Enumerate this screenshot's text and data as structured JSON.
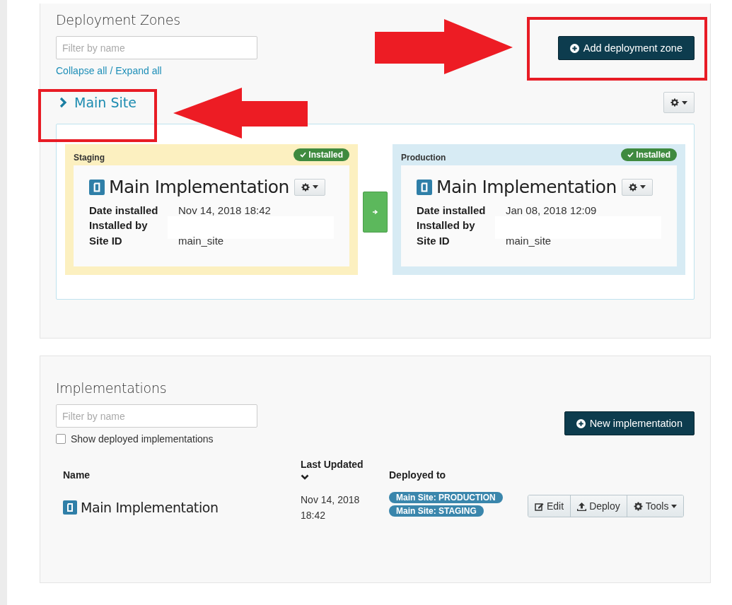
{
  "deployment_zones": {
    "title": "Deployment Zones",
    "filter": {
      "placeholder": "Filter by name"
    },
    "links": [
      "Collapse all",
      "Expand all"
    ],
    "link_separator": "/",
    "add_button": "Add deployment zone",
    "groups": [
      {
        "name": "Main Site",
        "environments": [
          {
            "kind": "staging",
            "label": "Staging",
            "status": "Installed",
            "implementation": "Main Implementation",
            "details": [
              {
                "label": "Date installed",
                "value": "Nov 14, 2018 18:42"
              },
              {
                "label": "Installed by",
                "redacted": true
              },
              {
                "label": "Site ID",
                "value": "main_site"
              }
            ]
          },
          {
            "kind": "production",
            "label": "Production",
            "status": "Installed",
            "implementation": "Main Implementation",
            "details": [
              {
                "label": "Date installed",
                "value": "Jan 08, 2018 12:09"
              },
              {
                "label": "Installed by",
                "redacted": true
              },
              {
                "label": "Site ID",
                "value": "main_site"
              }
            ]
          }
        ]
      }
    ]
  },
  "implementations": {
    "title": "Implementations",
    "filter": {
      "placeholder": "Filter by name"
    },
    "show_deployed": {
      "label": "Show deployed implementations",
      "checked": false
    },
    "new_button": "New implementation",
    "columns": [
      {
        "label": "Name",
        "sorted": false
      },
      {
        "label": "Last Updated",
        "sorted": true
      },
      {
        "label": "Deployed to",
        "sorted": false
      }
    ],
    "rows": [
      {
        "name": "Main Implementation",
        "last_updated": "Nov 14, 2018 18:42",
        "deployed_to": [
          "Main Site: PRODUCTION",
          "Main Site: STAGING"
        ],
        "actions": [
          {
            "kind": "edit",
            "label": "Edit"
          },
          {
            "kind": "deploy",
            "label": "Deploy"
          },
          {
            "kind": "tools",
            "label": "Tools"
          }
        ]
      }
    ]
  }
}
